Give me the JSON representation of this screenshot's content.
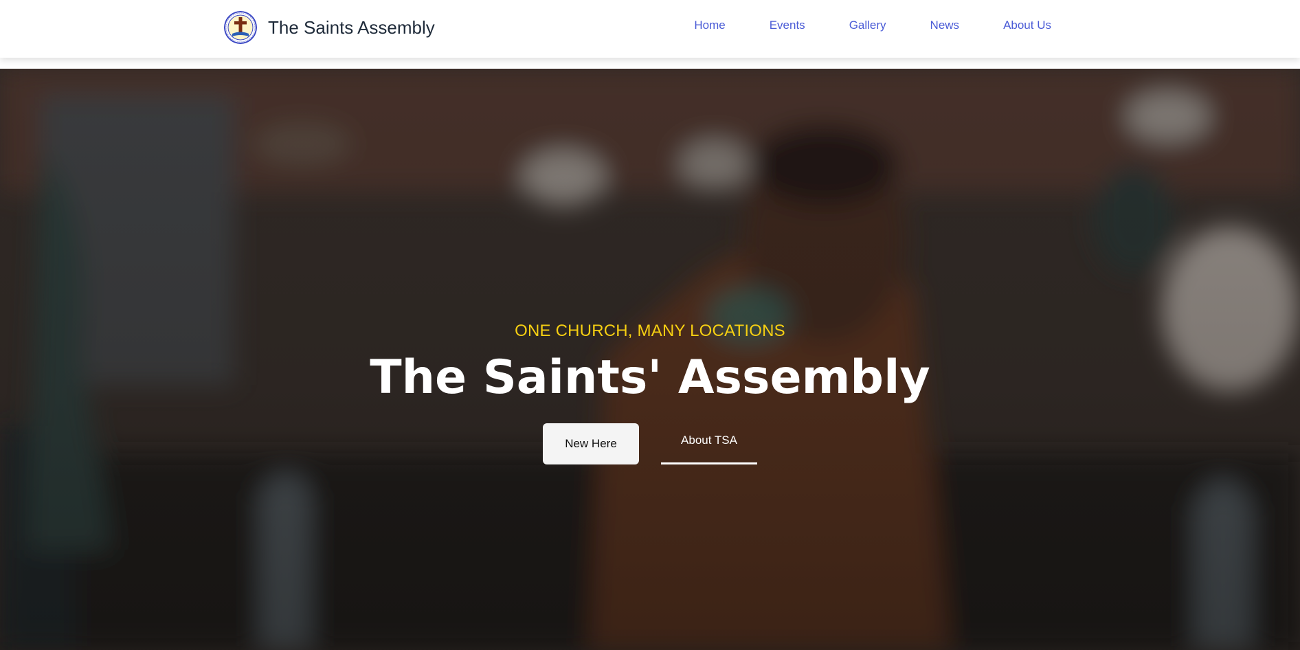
{
  "header": {
    "brand_name": "The Saints Assembly",
    "logo": "church-logo-icon",
    "nav": {
      "home": "Home",
      "events": "Events",
      "gallery": "Gallery",
      "news": "News",
      "about": "About Us"
    }
  },
  "hero": {
    "tagline": "ONE CHURCH, MANY LOCATIONS",
    "title": "The Saints' Assembly",
    "buttons": {
      "new_here": "New Here",
      "about_tsa": "About TSA"
    }
  },
  "colors": {
    "nav_link": "#4a5bd6",
    "tagline": "#f6cf12",
    "brand_text": "#1f2b3a",
    "hero_overlay": "#35302c"
  }
}
